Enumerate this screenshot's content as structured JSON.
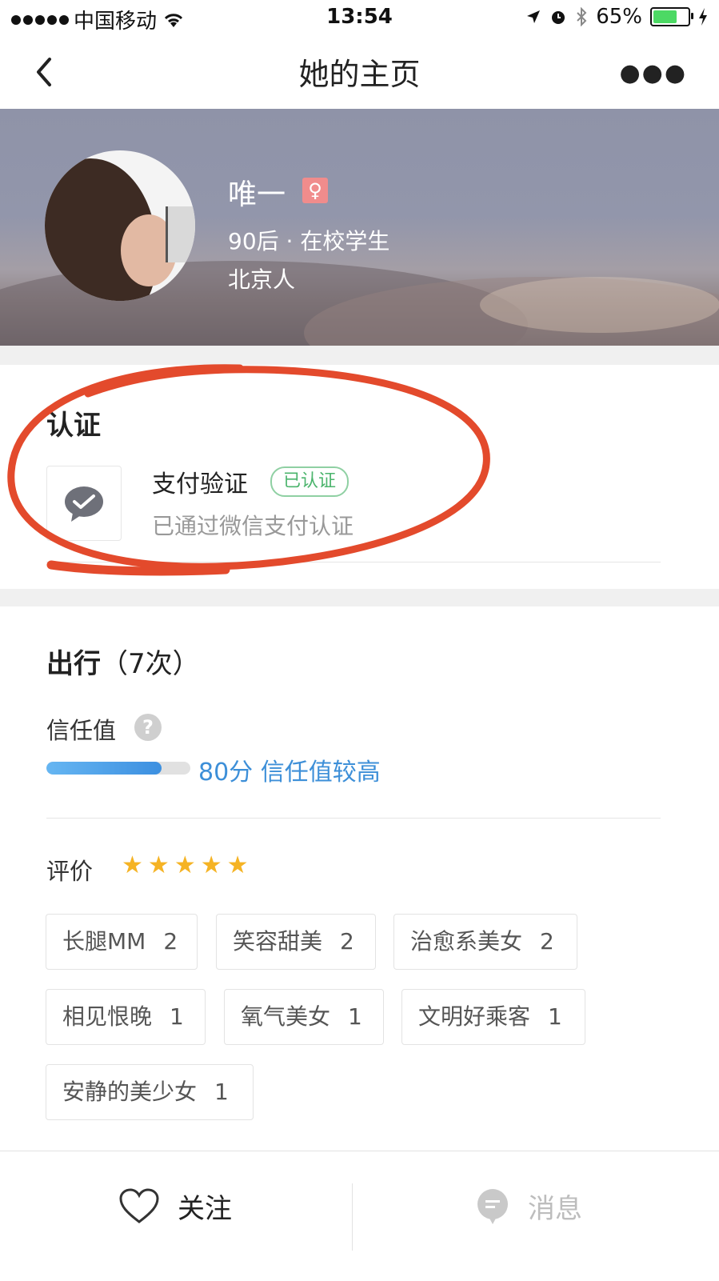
{
  "status_bar": {
    "carrier": "中国移动",
    "time": "13:54",
    "battery": "65%"
  },
  "nav": {
    "title": "她的主页"
  },
  "profile": {
    "name": "唯一",
    "gender_symbol": "♀",
    "meta_line1": "90后 · 在校学生",
    "meta_line2": "北京人"
  },
  "certification": {
    "title": "认证",
    "item_name": "支付验证",
    "badge": "已认证",
    "description": "已通过微信支付认证"
  },
  "trips": {
    "title_main": "出行",
    "title_count": "（7次）",
    "trust_label": "信任值",
    "trust_value_text": "80分 信任值较高",
    "trust_progress": 0.8,
    "rating_label": "评价",
    "rating_stars": 5,
    "tags": [
      {
        "label": "长腿MM",
        "count": "2"
      },
      {
        "label": "笑容甜美",
        "count": "2"
      },
      {
        "label": "治愈系美女",
        "count": "2"
      },
      {
        "label": "相见恨晚",
        "count": "1"
      },
      {
        "label": "氧气美女",
        "count": "1"
      },
      {
        "label": "文明好乘客",
        "count": "1"
      },
      {
        "label": "安静的美少女",
        "count": "1"
      }
    ]
  },
  "bottom": {
    "follow_label": "关注",
    "message_label": "消息"
  },
  "colors": {
    "accent_blue": "#3d8fd8",
    "star": "#f5b324",
    "verified_green": "#4bb46c",
    "annotation_red": "#e34a2c"
  }
}
